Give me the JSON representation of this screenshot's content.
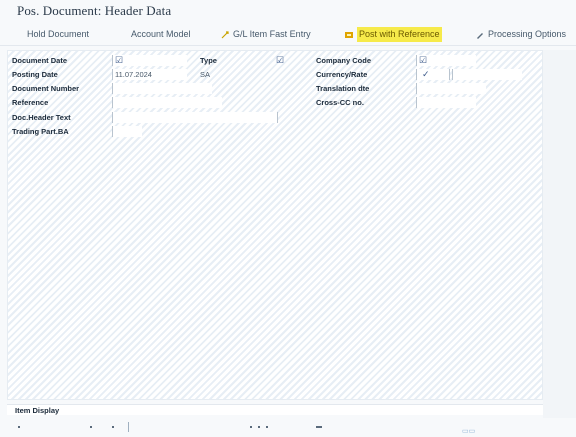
{
  "window": {
    "title": "Pos. Document: Header Data"
  },
  "toolbar": {
    "hold_document": "Hold Document",
    "account_model": "Account Model",
    "gl_item_fast_entry": "G/L Item Fast Entry",
    "post_with_reference": "Post with Reference",
    "processing_options": "Processing Options"
  },
  "form": {
    "document_date_label": "Document Date",
    "posting_date_label": "Posting Date",
    "posting_date_value": "11.07.2024",
    "document_number_label": "Document Number",
    "reference_label": "Reference",
    "doc_header_text_label": "Doc.Header Text",
    "trading_part_ba_label": "Trading Part.BA",
    "type_label": "Type",
    "type_value": "SA",
    "company_code_label": "Company Code",
    "currency_rate_label": "Currency/Rate",
    "translation_date_label": "Translation dte",
    "cross_cc_no_label": "Cross-CC no."
  },
  "bottom": {
    "items_label": "Item Display"
  },
  "colors": {
    "accent_highlight": "#f6ea4a",
    "hatch_line": "#e7eef5"
  }
}
